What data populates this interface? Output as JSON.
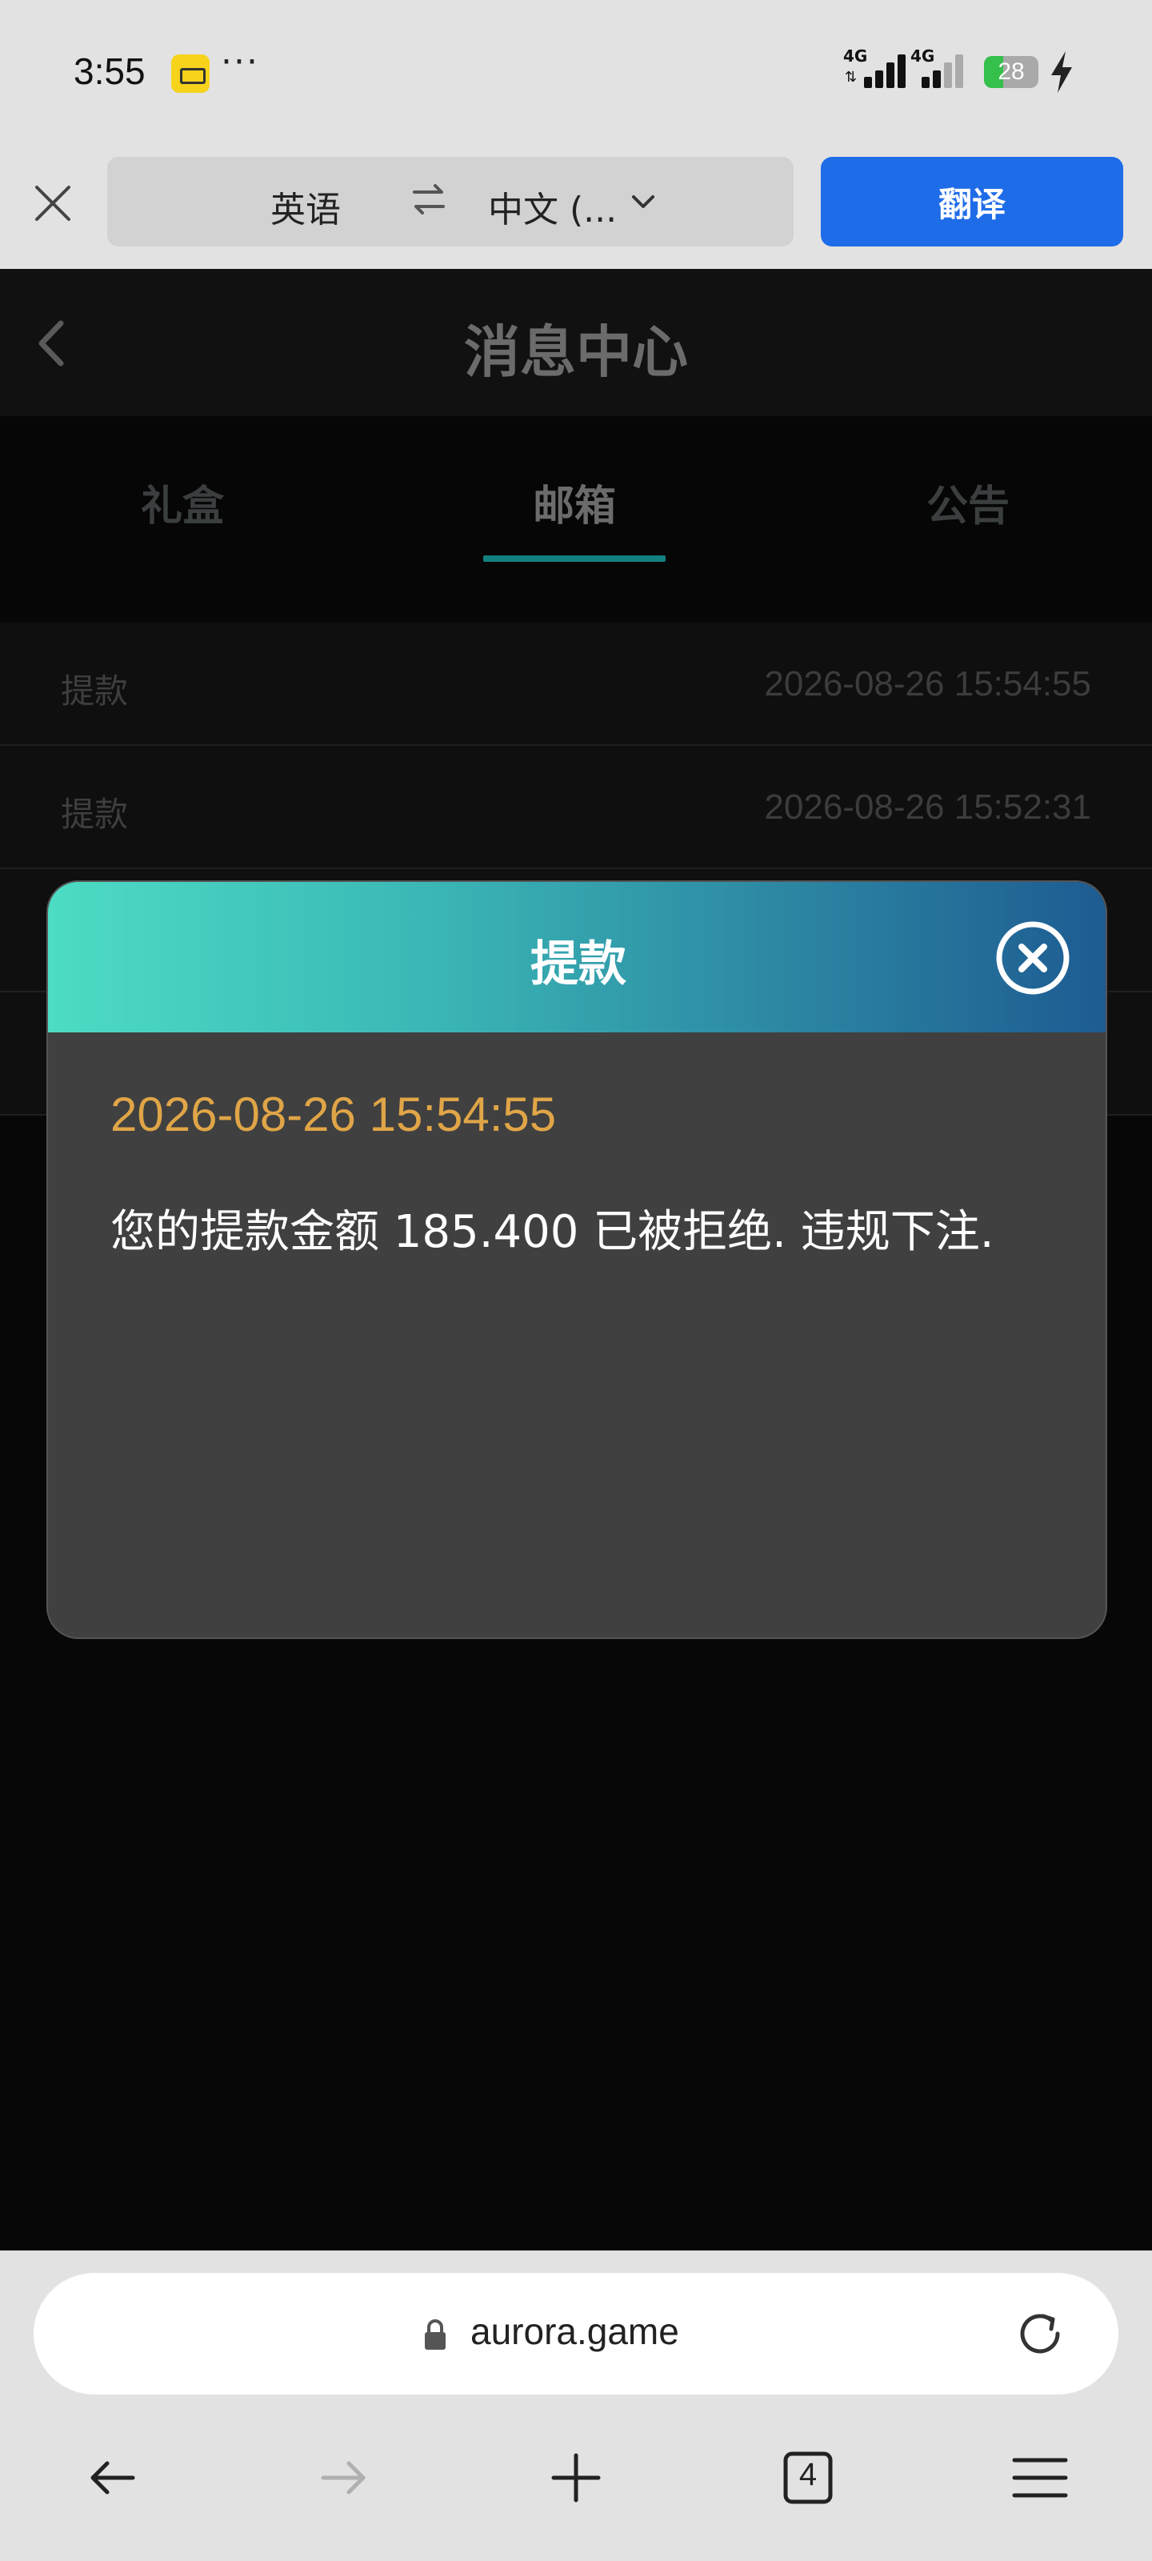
{
  "status_bar": {
    "time": "3:55",
    "more": "···",
    "network_1": "4G",
    "network_2": "4G",
    "battery": "28",
    "icons": [
      "app-notification-icon",
      "signal-icon",
      "battery-icon",
      "charging-icon"
    ]
  },
  "translate_bar": {
    "source_lang": "英语",
    "target_lang": "中文 (...",
    "translate_button": "翻译",
    "icons": [
      "close-icon",
      "swap-icon",
      "chevron-down-icon"
    ],
    "accent_color": "#1f6ce8"
  },
  "page": {
    "title": "消息中心",
    "tabs": [
      {
        "label": "礼盒"
      },
      {
        "label": "邮箱"
      },
      {
        "label": "公告"
      }
    ],
    "active_tab": "邮箱",
    "mails": [
      {
        "title": "提款",
        "time": "2026-08-26 15:54:55"
      },
      {
        "title": "提款",
        "time": "2026-08-26 15:52:31"
      }
    ]
  },
  "modal": {
    "title": "提款",
    "date": "2026-08-26 15:54:55",
    "message": "您的提款金额 185.400 已被拒绝. 违规下注.",
    "date_color": "#e0a547"
  },
  "browser": {
    "url": "aurora.game",
    "tab_count": "4",
    "icons": [
      "lock-icon",
      "reload-icon",
      "back-icon",
      "forward-icon",
      "new-tab-icon",
      "tabs-icon",
      "menu-icon"
    ]
  }
}
